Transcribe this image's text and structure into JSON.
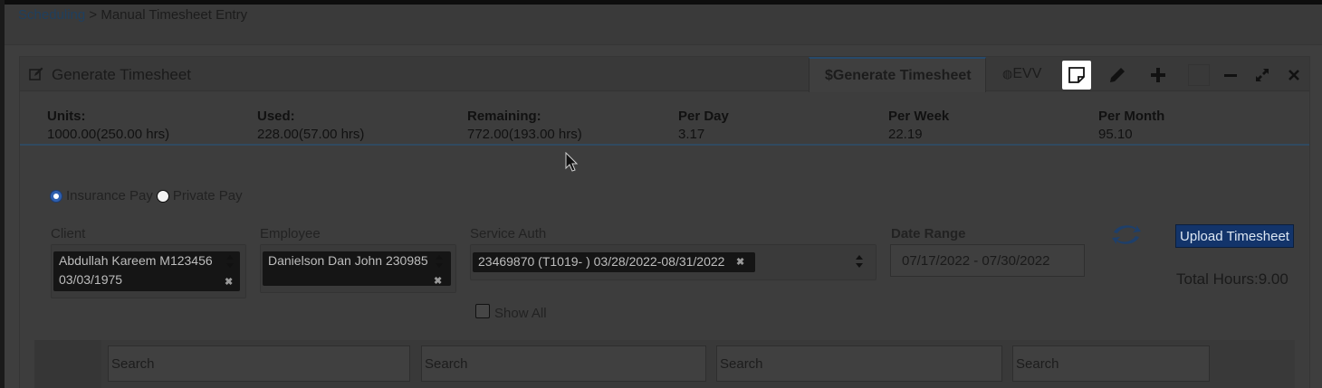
{
  "breadcrumb": {
    "link": "Scheduling",
    "separator": " > ",
    "current": "Manual Timesheet Entry"
  },
  "panel": {
    "title": "Generate Timesheet",
    "tabs": [
      {
        "label": "$Generate Timesheet",
        "active": true
      },
      {
        "label": "EVV",
        "active": false
      }
    ],
    "tools": [
      "sticky-note-icon",
      "pencil-icon",
      "plus-icon",
      "blank-box",
      "minus-icon",
      "expand-icon",
      "close-icon"
    ]
  },
  "stats": [
    {
      "label": "Units:",
      "value": "1000.00(250.00 hrs)"
    },
    {
      "label": "Used:",
      "value": "228.00(57.00 hrs)"
    },
    {
      "label": "Remaining:",
      "value": "772.00(193.00 hrs)"
    },
    {
      "label": "Per Day",
      "value": "3.17"
    },
    {
      "label": "Per Week",
      "value": "22.19"
    },
    {
      "label": "Per Month",
      "value": "95.10"
    }
  ],
  "pay_options": [
    {
      "label": "Insurance Pay",
      "selected": true
    },
    {
      "label": "Private Pay",
      "selected": false
    }
  ],
  "form": {
    "client_label": "Client",
    "client_value_line1": "Abdullah Kareem M123456",
    "client_value_line2": "03/03/1975",
    "employee_label": "Employee",
    "employee_value": "Danielson Dan John 230985",
    "service_auth_label": "Service Auth",
    "service_auth_value": "23469870 (T1019- ) 03/28/2022-08/31/2022",
    "date_range_label": "Date Range",
    "date_range_value": "07/17/2022 - 07/30/2022",
    "show_all_label": "Show All",
    "upload_label": "Upload Timesheet",
    "total_hours": "Total Hours:9.00"
  },
  "grid": {
    "search_placeholders": [
      "Search",
      "Search",
      "Search",
      "Search"
    ]
  },
  "colors": {
    "accent": "#13346a",
    "link": "#1f3f5e",
    "radio": "#2f5fae"
  }
}
